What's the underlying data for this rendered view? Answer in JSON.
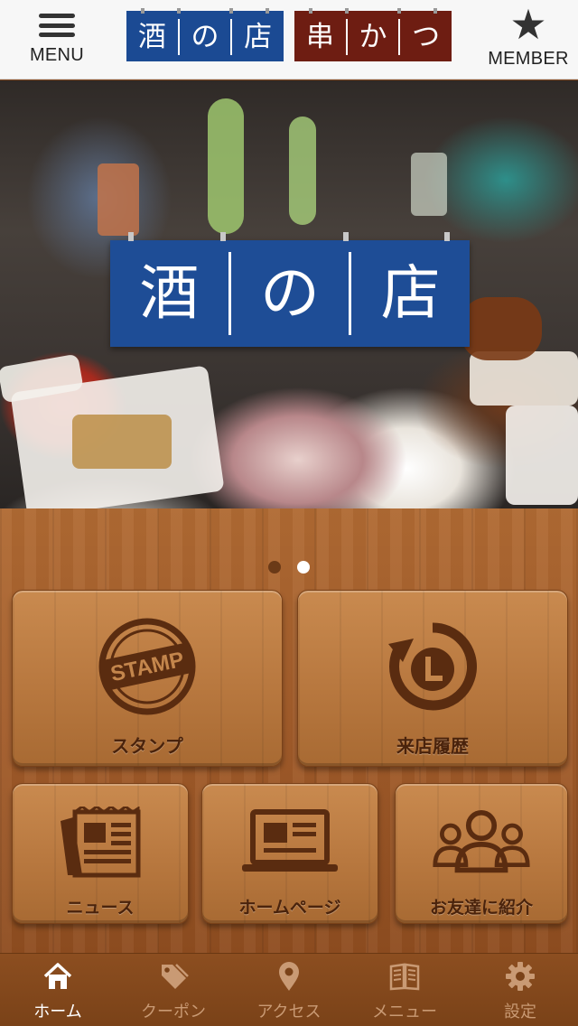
{
  "header": {
    "menu_label": "MENU",
    "member_label": "MEMBER",
    "logo_left": [
      "酒",
      "の",
      "店"
    ],
    "logo_right": [
      "串",
      "か",
      "つ"
    ],
    "logo_left_color": "#1b4a93",
    "logo_right_color": "#6e1d12"
  },
  "hero": {
    "sign_chars": [
      "酒",
      "の",
      "店"
    ],
    "sign_color": "#1e4d96",
    "carousel_pages": 2,
    "carousel_active": 2
  },
  "tiles": {
    "stamp": {
      "label": "スタンプ",
      "icon": "stamp-icon",
      "icon_text": "STAMP"
    },
    "history": {
      "label": "来店履歴",
      "icon": "history-clock-icon"
    },
    "news": {
      "label": "ニュース",
      "icon": "newspaper-icon"
    },
    "homepage": {
      "label": "ホームページ",
      "icon": "laptop-icon"
    },
    "friend": {
      "label": "お友達に紹介",
      "icon": "friends-icon"
    }
  },
  "tabbar": {
    "items": [
      {
        "label": "ホーム",
        "icon": "home-icon",
        "active": true
      },
      {
        "label": "クーポン",
        "icon": "coupon-tag-icon",
        "active": false
      },
      {
        "label": "アクセス",
        "icon": "map-pin-icon",
        "active": false
      },
      {
        "label": "メニュー",
        "icon": "book-icon",
        "active": false
      },
      {
        "label": "設定",
        "icon": "gear-icon",
        "active": false
      }
    ]
  },
  "colors": {
    "wood": "#a25c2a",
    "tile": "#b8783f",
    "tab_active": "#ffffff",
    "tab_inactive": "#c99a74",
    "icon_dark": "#5a2c10"
  }
}
